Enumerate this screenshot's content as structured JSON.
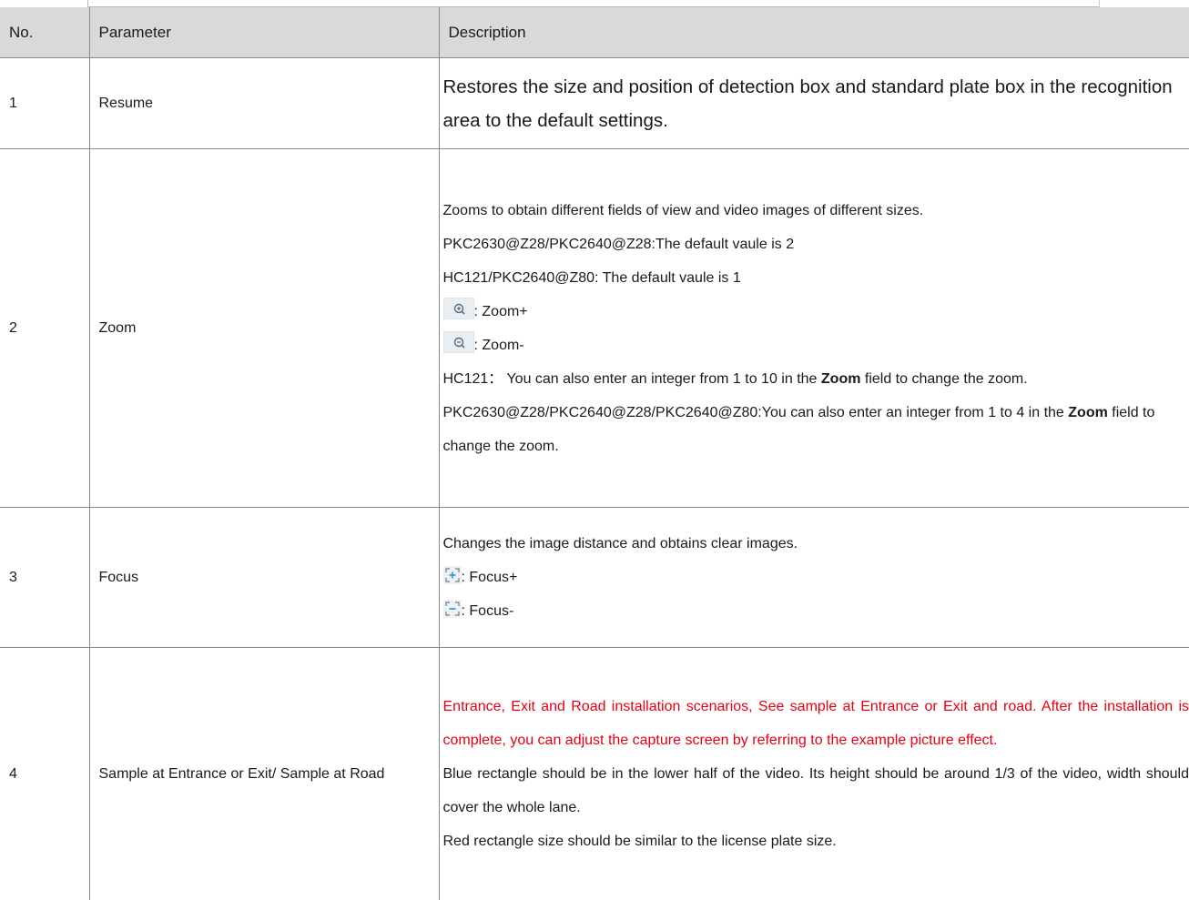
{
  "table": {
    "headers": {
      "no": "No.",
      "parameter": "Parameter",
      "description": "Description"
    },
    "rows": [
      {
        "no": "1",
        "parameter": "Resume",
        "lines": [
          "Restores the size and position of detection box and standard plate box in the recognition area to the default settings."
        ]
      },
      {
        "no": "2",
        "parameter": "Zoom",
        "line1": "Zooms to obtain different fields of view and video images of different sizes.",
        "line2": "PKC2630@Z28/PKC2640@Z28:The default vaule is 2",
        "line3": "HC121/PKC2640@Z80: The default vaule is 1",
        "zoom_in_label": ": Zoom+",
        "zoom_in_icon": "zoom-in-icon",
        "zoom_out_label": ": Zoom-",
        "zoom_out_icon": "zoom-out-icon",
        "hc121_prefix": "HC121：  You can also enter an integer from 1 to 10 in the ",
        "hc121_bold": "Zoom",
        "hc121_suffix": " field to change the zoom.",
        "pkc_prefix": "PKC2630@Z28/PKC2640@Z28/PKC2640@Z80:You can also enter an integer from 1 to 4 in the ",
        "pkc_bold": "Zoom",
        "pkc_suffix": " field to change the zoom."
      },
      {
        "no": "3",
        "parameter": "Focus",
        "line1": "Changes the image distance and obtains clear images.",
        "focus_in_label": ": Focus+",
        "focus_in_icon": "focus-plus-icon",
        "focus_out_label": ": Focus-",
        "focus_out_icon": "focus-minus-icon"
      },
      {
        "no": "4",
        "parameter": "Sample at Entrance or Exit/ Sample at Road",
        "red_text": "Entrance, Exit and Road installation scenarios, See sample at Entrance or Exit and road. After the installation is complete, you can adjust the capture screen by referring to the example picture effect.",
        "blue_text": "Blue rectangle should be in the lower half of the video. Its height should be around 1/3 of the video, width should cover the whole lane.",
        "red_rect_text": "Red rectangle size should be similar to the license plate size."
      }
    ]
  },
  "colors": {
    "header_bg": "#d9d9d9",
    "red": "#e60012",
    "border": "#8a8a8a"
  }
}
